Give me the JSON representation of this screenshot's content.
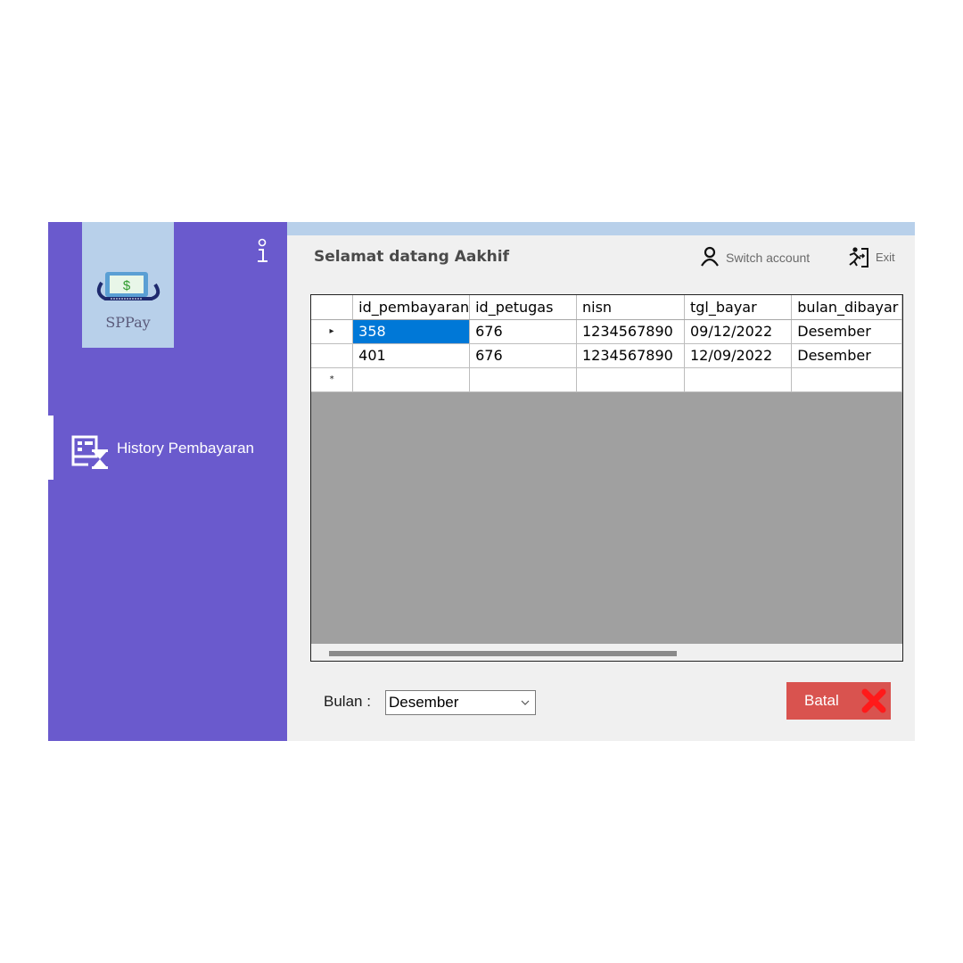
{
  "app": {
    "logo_text": "SPPay",
    "logo_symbol": "$",
    "welcome": "Selamat datang Aakhif",
    "info_icon": "info-icon"
  },
  "sidebar": {
    "items": [
      {
        "label": "History Pembayaran",
        "icon": "history-receipt-icon",
        "active": true
      }
    ]
  },
  "header": {
    "switch_account_label": "Switch account",
    "exit_label": "Exit"
  },
  "grid": {
    "columns": [
      "id_pembayaran",
      "id_petugas",
      "nisn",
      "tgl_bayar",
      "bulan_dibayar"
    ],
    "rows": [
      [
        "358",
        "676",
        "1234567890",
        "09/12/2022",
        "Desember"
      ],
      [
        "401",
        "676",
        "1234567890",
        "12/09/2022",
        "Desember"
      ]
    ],
    "selected_row": 0,
    "current_row_marker": "▸",
    "new_row_marker": "*"
  },
  "filter": {
    "label": "Bulan :",
    "selected": "Desember"
  },
  "actions": {
    "batal_label": "Batal"
  },
  "colors": {
    "sidebar": "#6a5acd",
    "accent": "#b8d0ea",
    "selection": "#0078d7",
    "cancel": "#d9534f"
  }
}
